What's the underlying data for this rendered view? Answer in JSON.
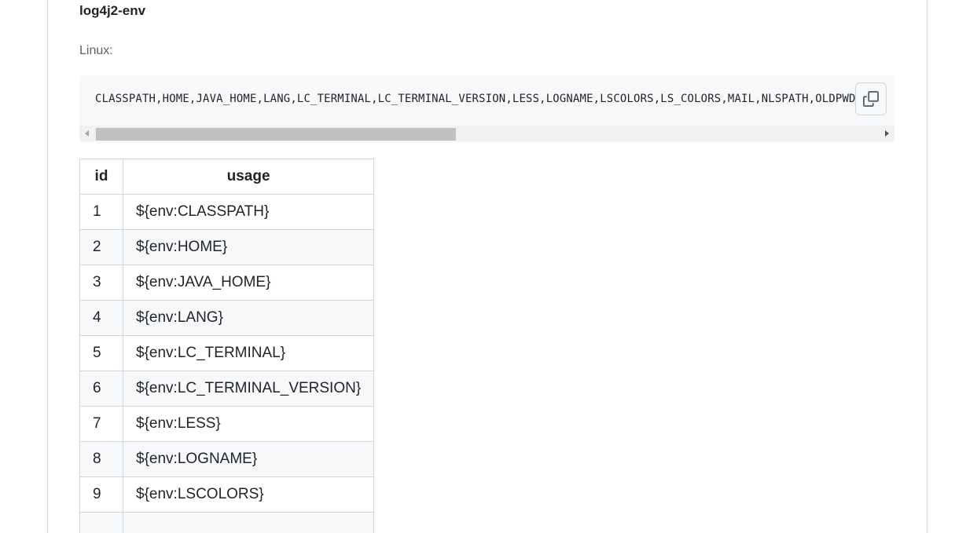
{
  "file": {
    "title": "log4j2-env"
  },
  "section": {
    "label": "Linux:"
  },
  "code": {
    "text": "CLASSPATH,HOME,JAVA_HOME,LANG,LC_TERMINAL,LC_TERMINAL_VERSION,LESS,LOGNAME,LSCOLORS,LS_COLORS,MAIL,NLSPATH,OLDPWD",
    "copy_icon": "copy-icon"
  },
  "table": {
    "headers": {
      "id": "id",
      "usage": "usage"
    },
    "rows": [
      {
        "id": "1",
        "usage": "${env:CLASSPATH}"
      },
      {
        "id": "2",
        "usage": "${env:HOME}"
      },
      {
        "id": "3",
        "usage": "${env:JAVA_HOME}"
      },
      {
        "id": "4",
        "usage": "${env:LANG}"
      },
      {
        "id": "5",
        "usage": "${env:LC_TERMINAL}"
      },
      {
        "id": "6",
        "usage": "${env:LC_TERMINAL_VERSION}"
      },
      {
        "id": "7",
        "usage": "${env:LESS}"
      },
      {
        "id": "8",
        "usage": "${env:LOGNAME}"
      },
      {
        "id": "9",
        "usage": "${env:LSCOLORS}"
      },
      {
        "id": "",
        "usage": ""
      }
    ]
  },
  "colors": {
    "text": "#1f2328",
    "muted": "#59636e",
    "border": "#d0d7de",
    "code_bg": "#f6f8fa"
  }
}
